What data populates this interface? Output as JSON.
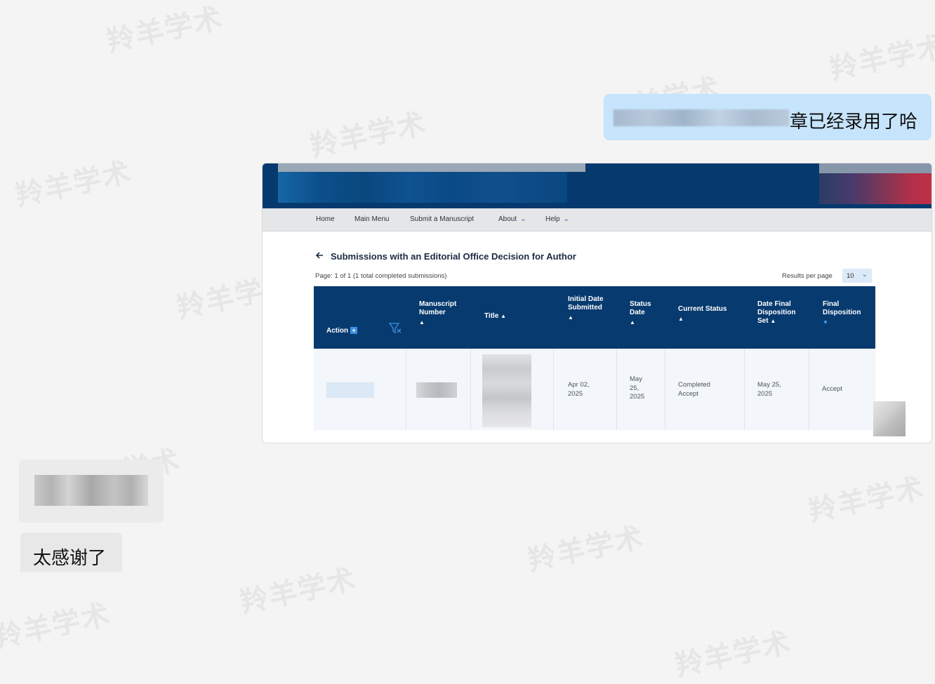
{
  "watermark": "羚羊学术",
  "chat": {
    "right_message": "章已经录用了哈",
    "left_message": "太感谢了"
  },
  "screenshot": {
    "nav": [
      {
        "label": "Home",
        "dropdown": false
      },
      {
        "label": "Main Menu",
        "dropdown": false
      },
      {
        "label": "Submit a Manuscript",
        "dropdown": false
      },
      {
        "label": "About",
        "dropdown": true
      },
      {
        "label": "Help",
        "dropdown": true
      }
    ],
    "page_title": "Submissions with an Editorial Office Decision for Author",
    "page_info": "Page: 1 of 1 (1 total completed submissions)",
    "results_per_page_label": "Results per page",
    "results_per_page_value": "10",
    "columns": {
      "action": "Action",
      "manuscript_number": "Manuscript Number",
      "title": "Title",
      "initial_date_submitted": "Initial Date Submitted",
      "status_date": "Status Date",
      "current_status": "Current Status",
      "date_final_disposition_set": "Date Final Disposition Set",
      "final_disposition": "Final Disposition"
    },
    "row": {
      "initial_date_submitted": "Apr 02, 2025",
      "status_date": "May 25, 2025",
      "current_status": "Completed Accept",
      "date_final_disposition_set": "May 25, 2025",
      "final_disposition": "Accept"
    }
  },
  "colors": {
    "chat_right_bg": "#c6e4fb",
    "header_navy": "#063a6e",
    "accent_blue": "#2a6db3"
  }
}
